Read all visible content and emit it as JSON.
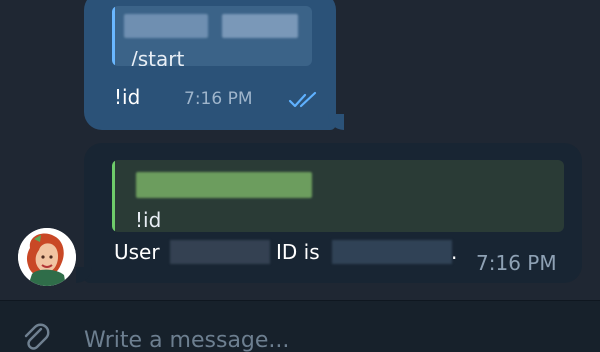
{
  "colors": {
    "background": "#1f2733",
    "outgoing_bubble": "#2b5278",
    "incoming_bubble": "#182533",
    "composer_bg": "#17212b",
    "reply_bar_out": "#6ab7ff",
    "reply_bar_in": "#6ecb6a",
    "read_receipt": "#5fb1ff"
  },
  "icons": {
    "read_receipt": "double-check-icon",
    "attach": "paperclip-icon"
  },
  "outgoing_message": {
    "reply_command": "/start",
    "text": "!id",
    "time": "7:16 PM"
  },
  "incoming_message": {
    "reply_command": "!id",
    "text_user": "User",
    "text_id": "ID is",
    "text_period": ".",
    "time": "7:16 PM"
  },
  "composer": {
    "placeholder": "Write a message..."
  }
}
